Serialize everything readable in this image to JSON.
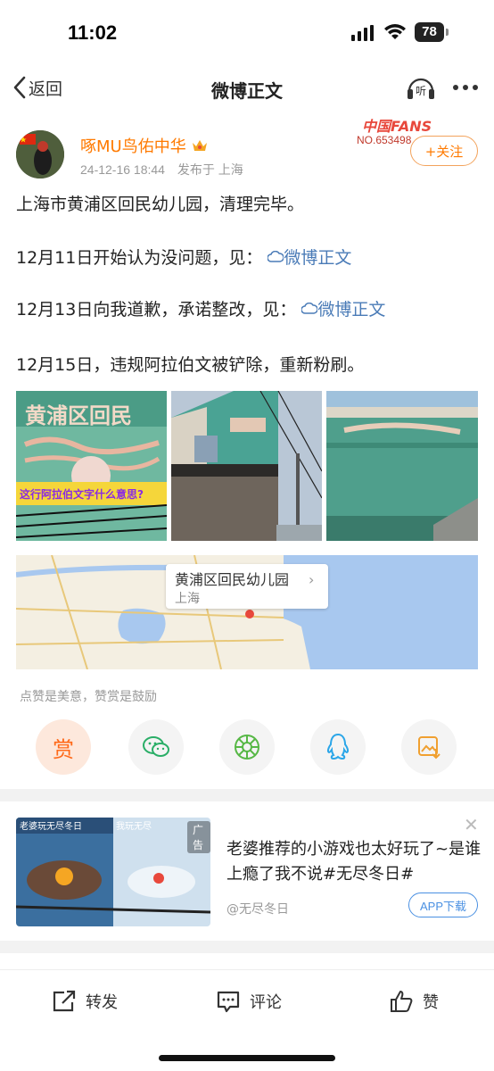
{
  "status_bar": {
    "time": "11:02",
    "battery": "78"
  },
  "nav": {
    "back_label": "返回",
    "title": "微博正文",
    "listen_icon_text": "听"
  },
  "post": {
    "username": "啄MU鸟佑中华",
    "date": "24-12-16 18:44",
    "published_from": "发布于 上海",
    "fans_badge_title": "中国FANS",
    "fans_badge_number": "NO.653498",
    "follow_label": "+关注",
    "paragraphs": [
      {
        "text": "上海市黄浦区回民幼儿园，清理完毕。"
      },
      {
        "text": "12月11日开始认为没问题，见：",
        "link": "微博正文"
      },
      {
        "text": "12月13日向我道歉，承诺整改，见：",
        "link": "微博正文"
      },
      {
        "text": "12月15日，违规阿拉伯文被铲除，重新粉刷。"
      }
    ],
    "photo1_overlay": "这行阿拉伯文字什么意思?",
    "photo1_sign": "黄浦区回民",
    "location": {
      "title": "黄浦区回民幼儿园",
      "city": "上海"
    },
    "reward_note": "点赞是美意，赞赏是鼓励",
    "reward_label": "赏"
  },
  "share_targets": [
    {
      "name": "reward",
      "icon": "reward-icon"
    },
    {
      "name": "wechat",
      "icon": "wechat-icon",
      "color": "#2aae67"
    },
    {
      "name": "moments",
      "icon": "moments-icon",
      "color": "#57b846"
    },
    {
      "name": "qq",
      "icon": "qq-icon",
      "color": "#2ba6e8"
    },
    {
      "name": "save-image",
      "icon": "save-image-icon",
      "color": "#f0a030"
    }
  ],
  "ad": {
    "tag": "广告",
    "text": "老婆推荐的小游戏也太好玩了~是谁上瘾了我不说#无尽冬日#",
    "source": "@无尽冬日",
    "download_label": "APP下载",
    "image_left_caption": "老婆玩无尽冬日",
    "image_right_caption": "我玩无尽"
  },
  "bottom_bar": {
    "repost": "转发",
    "comment": "评论",
    "like": "赞"
  },
  "colors": {
    "accent_orange": "#ff7a00",
    "link_blue": "#4a7bb7"
  }
}
